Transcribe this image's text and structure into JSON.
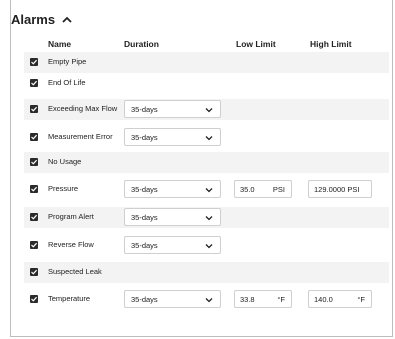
{
  "section": {
    "title": "Alarms"
  },
  "columns": {
    "name": "Name",
    "duration": "Duration",
    "low_limit": "Low Limit",
    "high_limit": "High Limit"
  },
  "alarms": [
    {
      "name": "Empty Pipe",
      "checked": true
    },
    {
      "name": "End Of Life",
      "checked": true
    },
    {
      "name": "Exceeding Max Flow",
      "checked": true,
      "duration": "35-days"
    },
    {
      "name": "Measurement Error",
      "checked": true,
      "duration": "35-days"
    },
    {
      "name": "No Usage",
      "checked": true
    },
    {
      "name": "Pressure",
      "checked": true,
      "duration": "35-days",
      "low_value": "35.0",
      "low_unit": "PSI",
      "high_value": "129.0000 PSI"
    },
    {
      "name": "Program Alert",
      "checked": true,
      "duration": "35-days"
    },
    {
      "name": "Reverse Flow",
      "checked": true,
      "duration": "35-days"
    },
    {
      "name": "Suspected Leak",
      "checked": true
    },
    {
      "name": "Temperature",
      "checked": true,
      "duration": "35-days",
      "low_value": "33.8",
      "low_unit": "°F",
      "high_value": "140.0",
      "high_unit": "°F"
    }
  ]
}
